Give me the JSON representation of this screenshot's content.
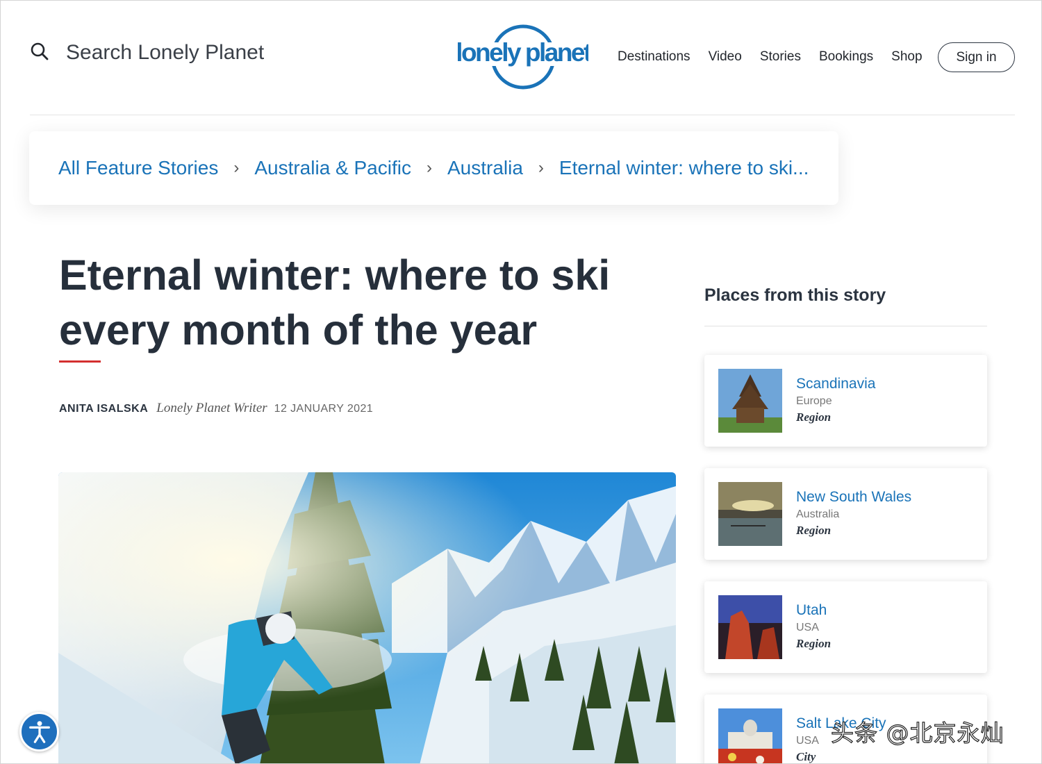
{
  "header": {
    "search_placeholder": "Search Lonely Planet",
    "logo_text": "lonely planet",
    "nav": [
      "Destinations",
      "Video",
      "Stories",
      "Bookings",
      "Shop"
    ],
    "signin_label": "Sign in"
  },
  "breadcrumb": [
    "All Feature Stories",
    "Australia & Pacific",
    "Australia",
    "Eternal winter: where to ski..."
  ],
  "article": {
    "title": "Eternal winter: where to ski every month of the year",
    "author": "ANITA ISALSKA",
    "role": "Lonely Planet Writer",
    "date": "12 JANUARY 2021"
  },
  "sidebar": {
    "title": "Places from this story",
    "places": [
      {
        "name": "Scandinavia",
        "parent": "Europe",
        "type": "Region"
      },
      {
        "name": "New South Wales",
        "parent": "Australia",
        "type": "Region"
      },
      {
        "name": "Utah",
        "parent": "USA",
        "type": "Region"
      },
      {
        "name": "Salt Lake City",
        "parent": "USA",
        "type": "City"
      }
    ]
  },
  "watermark": "头条 @北京永灿",
  "colors": {
    "link": "#1a73b8",
    "accent_rule": "#d32f2f",
    "accessibility_button": "#1e6fbd"
  },
  "icons": {
    "search": "search-icon",
    "accessibility": "accessibility-icon"
  }
}
